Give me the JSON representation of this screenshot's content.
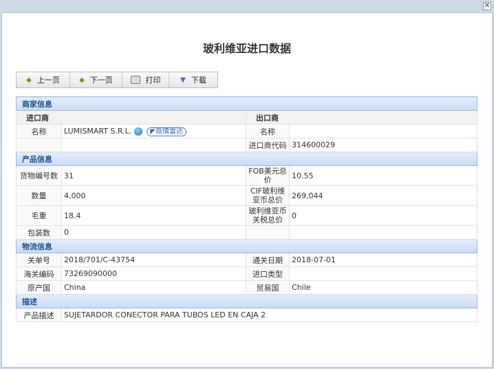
{
  "title": "玻利维亚进口数据",
  "toolbar": {
    "prev": "上一页",
    "next": "下一页",
    "print": "打印",
    "download": "下载"
  },
  "merchant": {
    "section": "商家信息",
    "importer": "进口商",
    "exporter": "出口商",
    "name_label": "名称",
    "importer_name": "LUMISMART S.R.L.",
    "radar": "商情雷达",
    "exporter_name_label": "名称",
    "exporter_name": "",
    "importer_code_label": "进口商代码",
    "importer_code": "314600029"
  },
  "product": {
    "section": "产品信息",
    "rows": [
      {
        "l1": "货物编号数",
        "v1": "31",
        "l2": "FOB美元总价",
        "v2": "10.55"
      },
      {
        "l1": "数量",
        "v1": "4,000",
        "l2": "CIF玻利维亚币总价",
        "v2": "269,044"
      },
      {
        "l1": "毛重",
        "v1": "18.4",
        "l2": "玻利维亚币关税总价",
        "v2": "0"
      },
      {
        "l1": "包装数",
        "v1": "0",
        "l2": "",
        "v2": ""
      }
    ]
  },
  "logistics": {
    "section": "物流信息",
    "rows": [
      {
        "l1": "关单号",
        "v1": "2018/701/C-43754",
        "l2": "通关日期",
        "v2": "2018-07-01"
      },
      {
        "l1": "海关编码",
        "v1": "73269090000",
        "l2": "进口类型",
        "v2": ""
      },
      {
        "l1": "原产国",
        "v1": "China",
        "l2": "贸易国",
        "v2": "Chile"
      }
    ]
  },
  "description": {
    "section": "描述",
    "label": "产品描述",
    "value": "SUJETARDOR CONECTOR PARA TUBOS LED EN CAJA 2"
  }
}
